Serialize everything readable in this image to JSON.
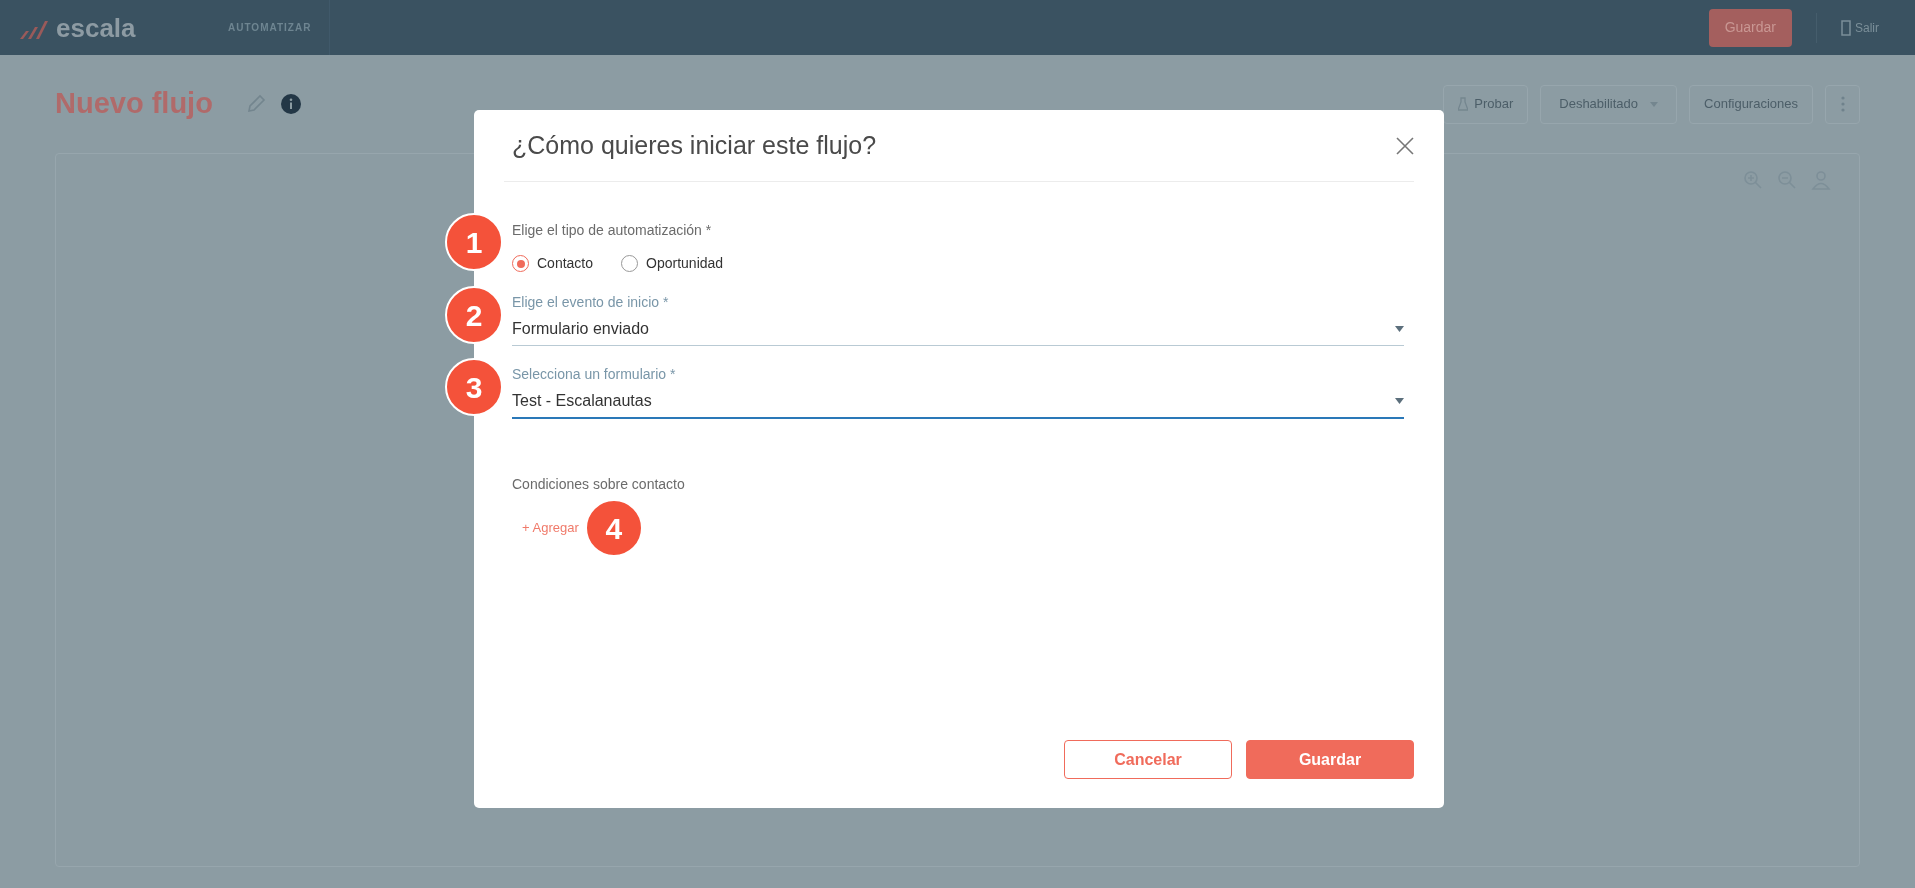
{
  "top_bar": {
    "logo": "escala",
    "section": "AUTOMATIZAR",
    "save_button": "Guardar",
    "exit_link": "Salir"
  },
  "page": {
    "title": "Nuevo flujo",
    "actions": [
      {
        "label": "Probar",
        "kind": "icon_button"
      },
      {
        "label": "Deshabilitado",
        "kind": "dropdown"
      },
      {
        "label": "Configuraciones",
        "kind": "plain"
      }
    ]
  },
  "modal": {
    "title": "¿Cómo quieres iniciar este flujo?",
    "automation_type": {
      "label": "Elige el tipo de automatización *",
      "callout": "1",
      "options": [
        {
          "label": "Contacto",
          "selected": true
        },
        {
          "label": "Oportunidad",
          "selected": false
        }
      ]
    },
    "fields": [
      {
        "label": "Elige el evento de inicio *",
        "value": "Formulario enviado",
        "focused": false,
        "callout": "2"
      },
      {
        "label": "Selecciona un formulario *",
        "value": "Test - Escalanautas",
        "focused": true,
        "callout": "3"
      }
    ],
    "conditions": {
      "label": "Condiciones sobre contacto",
      "add_link": "+ Agregar",
      "callout": "4"
    },
    "buttons": [
      {
        "label": "Cancelar",
        "kind": "secondary"
      },
      {
        "label": "Guardar",
        "kind": "primary"
      }
    ]
  }
}
